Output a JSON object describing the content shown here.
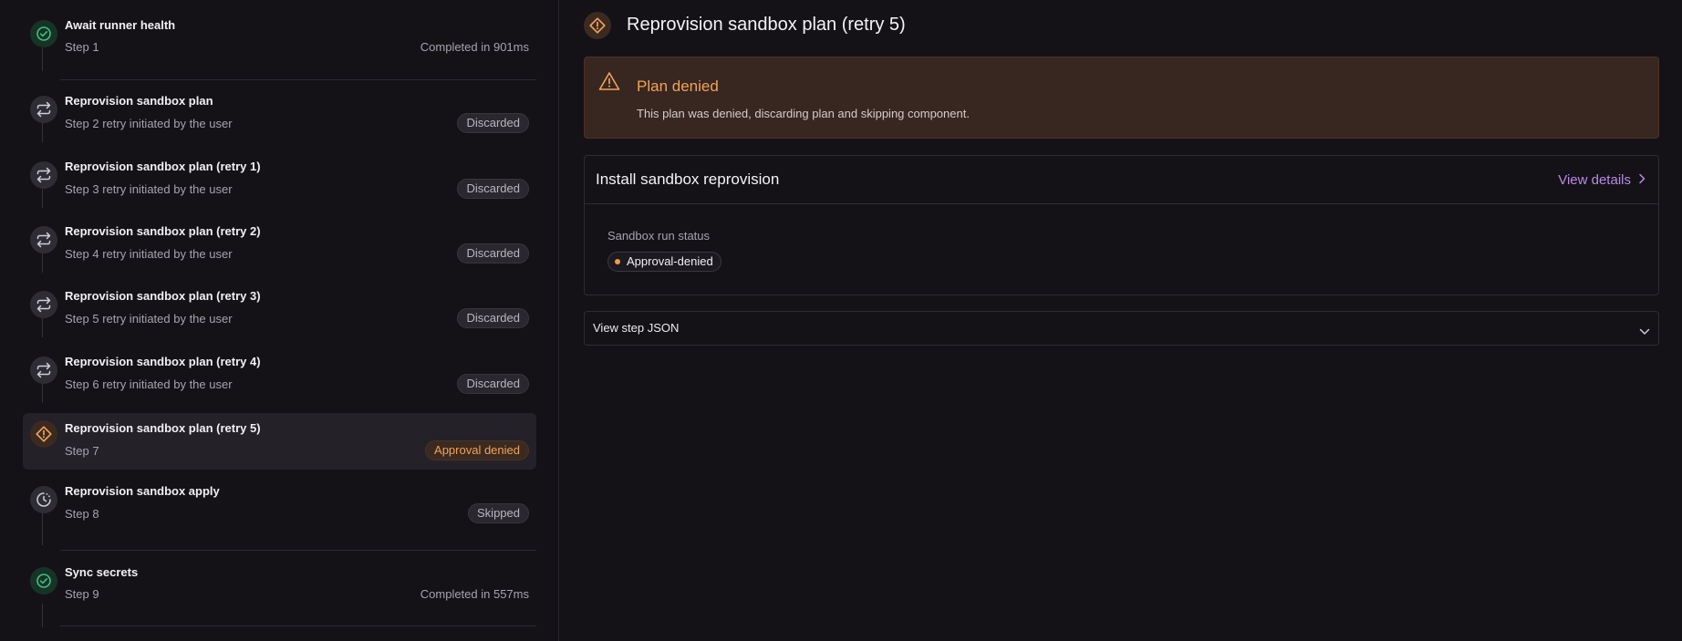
{
  "steps": [
    {
      "title": "Await runner health",
      "sub": "Step 1",
      "meta": "Completed in 901ms",
      "icon": "check-circle-icon"
    },
    {
      "title": "Reprovision sandbox plan",
      "sub": "Step 2 retry initiated by the user",
      "badge": "Discarded",
      "icon": "retry-icon"
    },
    {
      "title": "Reprovision sandbox plan (retry 1)",
      "sub": "Step 3 retry initiated by the user",
      "badge": "Discarded",
      "icon": "retry-icon"
    },
    {
      "title": "Reprovision sandbox plan (retry 2)",
      "sub": "Step 4 retry initiated by the user",
      "badge": "Discarded",
      "icon": "retry-icon"
    },
    {
      "title": "Reprovision sandbox plan (retry 3)",
      "sub": "Step 5 retry initiated by the user",
      "badge": "Discarded",
      "icon": "retry-icon"
    },
    {
      "title": "Reprovision sandbox plan (retry 4)",
      "sub": "Step 6 retry initiated by the user",
      "badge": "Discarded",
      "icon": "retry-icon"
    },
    {
      "title": "Reprovision sandbox plan (retry 5)",
      "sub": "Step 7",
      "badge": "Approval denied",
      "icon": "warning-diamond-icon"
    },
    {
      "title": "Reprovision sandbox apply",
      "sub": "Step 8",
      "badge": "Skipped",
      "icon": "pending-clock-icon"
    },
    {
      "title": "Sync secrets",
      "sub": "Step 9",
      "meta": "Completed in 557ms",
      "icon": "check-circle-icon"
    }
  ],
  "detail": {
    "title": "Reprovision sandbox plan (retry 5)",
    "alert": {
      "title": "Plan denied",
      "body": "This plan was denied, discarding plan and skipping component."
    },
    "card": {
      "title": "Install sandbox reprovision",
      "link": "View details",
      "field_label": "Sandbox run status",
      "status": "Approval-denied"
    },
    "json_toggle": "View step JSON"
  },
  "colors": {
    "accent_link": "#b98ae8",
    "warning": "#f2a25a",
    "success": "#3fbf7f"
  }
}
